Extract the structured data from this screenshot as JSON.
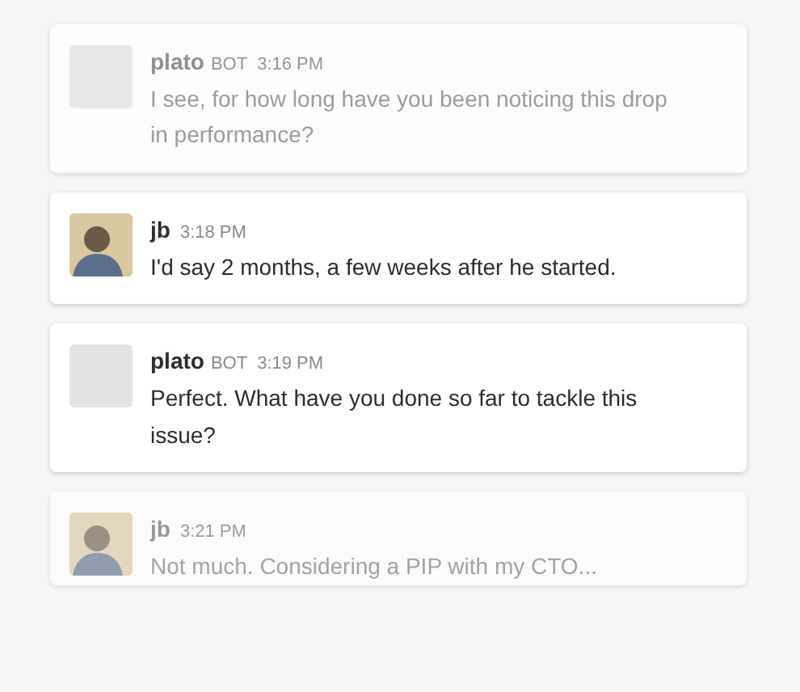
{
  "messages": [
    {
      "author": "plato",
      "kind": "bot",
      "bot_tag": "BOT",
      "time": "3:16 PM",
      "text": "I see, for how long have you been noticing this drop in performance?",
      "faded": true
    },
    {
      "author": "jb",
      "kind": "user",
      "time": "3:18 PM",
      "text": "I'd say 2 months, a few weeks after he started.",
      "faded": false
    },
    {
      "author": "plato",
      "kind": "bot",
      "bot_tag": "BOT",
      "time": "3:19 PM",
      "text": "Perfect. What have you done so far to tackle this issue?",
      "faded": false
    },
    {
      "author": "jb",
      "kind": "user",
      "time": "3:21 PM",
      "text": "Not much. Considering a PIP with my CTO...",
      "faded": true
    }
  ]
}
